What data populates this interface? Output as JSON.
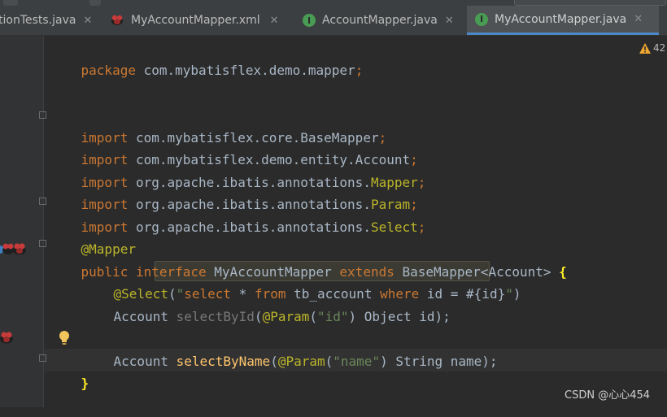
{
  "tabs": [
    {
      "title": "tionTests.java",
      "active": false
    },
    {
      "title": "MyAccountMapper.xml",
      "active": false
    },
    {
      "title": "AccountMapper.java",
      "active": false
    },
    {
      "title": "MyAccountMapper.java",
      "active": true
    }
  ],
  "close_glyph": "✕",
  "tab_icon_letter": "I",
  "editor": {
    "warning_count": "42",
    "lines": {
      "package_kw": "package",
      "package_name": " com.mybatisflex.demo.mapper",
      "semicolon": ";",
      "import_kw": "import",
      "imp1": " com.mybatisflex.core.BaseMapper",
      "imp2": " com.mybatisflex.demo.entity.Account",
      "imp3_prefix": " org.apache.ibatis.annotations.",
      "imp3_class": "Mapper",
      "imp4_class": "Param",
      "imp5_class": "Select",
      "mapper_annotation": "@Mapper",
      "iface_public": "public",
      "iface_interface": " interface",
      "iface_name": " MyAccountMapper",
      "iface_extends": " extends",
      "iface_base": " BaseMapper<Account> ",
      "iface_brace": "{",
      "select_ann": "@Select",
      "paren_open": "(",
      "quote": "\"",
      "sql_select": "select",
      "sql_star": " * ",
      "sql_from": "from",
      "sql_table": " tb_account ",
      "sql_where": "where",
      "sql_cond": " id = #{id}",
      "paren_close_str": ")",
      "m1_type": "Account ",
      "m1_name": "selectById",
      "param_ann": "@Param",
      "m1_arg_str": "\"id\"",
      "m1_rest": ") Object id);",
      "m2_type": "Account ",
      "m2_name": "selectByName",
      "m2_arg_str": "\"name\"",
      "m2_rest": ") String name);",
      "close_brace": "}"
    }
  },
  "watermark": "CSDN @心心454",
  "colors": {
    "keyword": "#cc7832",
    "annotation": "#bbb529",
    "string": "#6a8759",
    "method": "#ffc66d",
    "text": "#a9b7c6",
    "active_tab_underline": "#4a88c7"
  },
  "icons": [
    "close-icon",
    "mybatis-bird-icon",
    "interface-icon",
    "warning-icon",
    "lightbulb-icon",
    "fold-marker-icon"
  ]
}
